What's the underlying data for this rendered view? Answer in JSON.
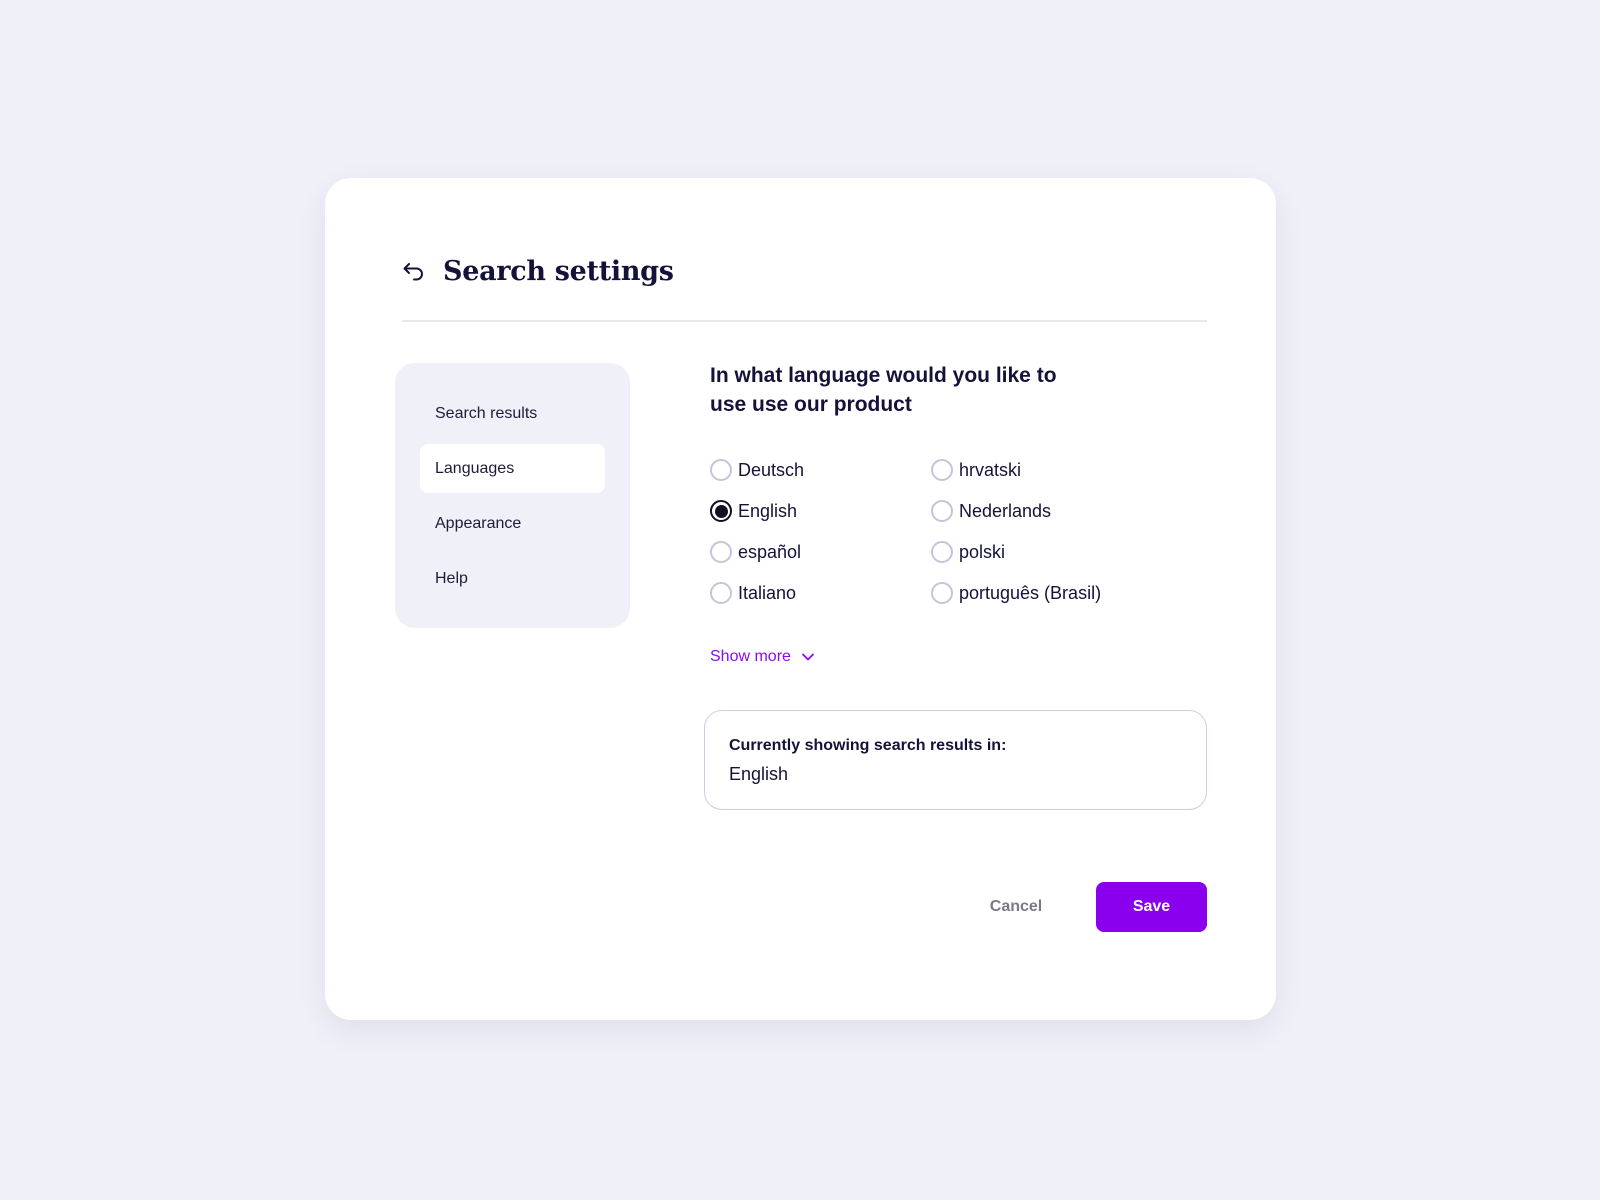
{
  "header": {
    "title": "Search settings",
    "back_icon": "back-arrow-icon"
  },
  "sidebar": {
    "items": [
      {
        "label": "Search results",
        "active": false
      },
      {
        "label": "Languages",
        "active": true
      },
      {
        "label": "Appearance",
        "active": false
      },
      {
        "label": "Help",
        "active": false
      }
    ]
  },
  "main": {
    "question_line1": "In what language would you like to",
    "question_line2": "use use our product",
    "languages": [
      {
        "label": "Deutsch",
        "selected": false
      },
      {
        "label": "English",
        "selected": true
      },
      {
        "label": "español",
        "selected": false
      },
      {
        "label": "Italiano",
        "selected": false
      },
      {
        "label": "hrvatski",
        "selected": false
      },
      {
        "label": "Nederlands",
        "selected": false
      },
      {
        "label": "polski",
        "selected": false
      },
      {
        "label": "português (Brasil)",
        "selected": false
      }
    ],
    "show_more_label": "Show more",
    "show_more_icon": "chevron-down-icon",
    "current_label": "Currently showing search results in:",
    "current_value": "English"
  },
  "actions": {
    "cancel_label": "Cancel",
    "save_label": "Save"
  },
  "colors": {
    "accent": "#8a00ee",
    "background": "#eff0f8",
    "card": "#ffffff"
  }
}
